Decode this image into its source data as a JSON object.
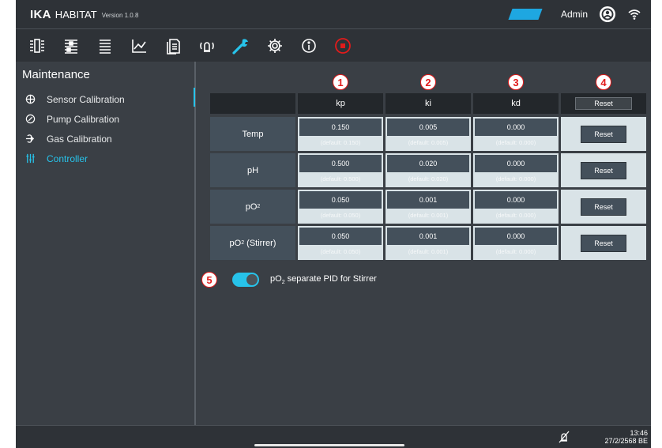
{
  "header": {
    "brand": "IKA",
    "product": "HABITAT",
    "version": "Version 1.0.8",
    "user": "Admin",
    "accent_color": "#27c3ea",
    "icons": [
      "profile-icon",
      "wifi-icon"
    ]
  },
  "toolbar": {
    "items": [
      {
        "icon": "overview-icon"
      },
      {
        "icon": "parameters-icon"
      },
      {
        "icon": "list-icon"
      },
      {
        "icon": "chart-icon"
      },
      {
        "icon": "document-icon"
      },
      {
        "icon": "alarm-icon"
      },
      {
        "icon": "wrench-icon",
        "active": true
      },
      {
        "icon": "settings-gear-icon"
      },
      {
        "icon": "info-icon"
      },
      {
        "icon": "stop-icon"
      }
    ]
  },
  "sidebar": {
    "title": "Maintenance",
    "items": [
      {
        "label": "Sensor Calibration",
        "icon": "crosshair-icon"
      },
      {
        "label": "Pump Calibration",
        "icon": "gauge-icon"
      },
      {
        "label": "Gas Calibration",
        "icon": "gas-icon"
      },
      {
        "label": "Controller",
        "icon": "sliders-icon",
        "active": true
      }
    ]
  },
  "table": {
    "markers": [
      "1",
      "2",
      "3",
      "4"
    ],
    "columns": [
      "kp",
      "ki",
      "kd"
    ],
    "header_reset": "Reset",
    "rows": [
      {
        "label": "Temp",
        "label_sub": "",
        "label_suffix": "",
        "values": [
          "0.150",
          "0.005",
          "0.000"
        ],
        "defaults": [
          "(default: 0.150)",
          "(default: 0.005)",
          "(default: 0.000)"
        ],
        "reset": "Reset"
      },
      {
        "label": "pH",
        "label_sub": "",
        "label_suffix": "",
        "values": [
          "0.500",
          "0.020",
          "0.000"
        ],
        "defaults": [
          "(default: 0.500)",
          "(default: 0.020)",
          "(default: 0.000)"
        ],
        "reset": "Reset"
      },
      {
        "label": "pO",
        "label_sub": "2",
        "label_suffix": "",
        "values": [
          "0.050",
          "0.001",
          "0.000"
        ],
        "defaults": [
          "(default: 0.050)",
          "(default: 0.001)",
          "(default: 0.000)"
        ],
        "reset": "Reset"
      },
      {
        "label": "pO",
        "label_sub": "2",
        "label_suffix": " (Stirrer)",
        "values": [
          "0.050",
          "0.001",
          "0.000"
        ],
        "defaults": [
          "(default: 0.050)",
          "(default: 0.001)",
          "(default: 0.000)"
        ],
        "reset": "Reset"
      }
    ]
  },
  "toggle": {
    "marker": "5",
    "on": true,
    "label_pre": "pO",
    "label_sub": "2",
    "label_post": " separate PID for Stirrer"
  },
  "status": {
    "time": "13:46",
    "date": "27/2/2568 BE",
    "icons": [
      "sound-muted-icon"
    ]
  }
}
